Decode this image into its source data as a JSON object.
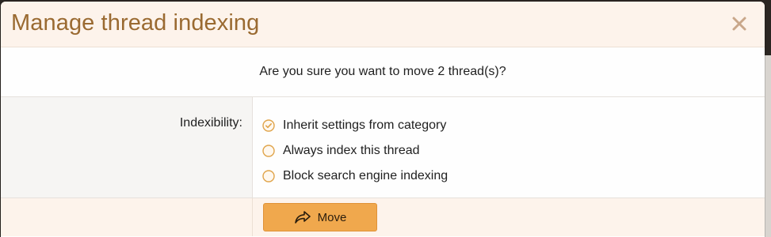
{
  "dialog": {
    "title": "Manage thread indexing",
    "close_icon": "close-icon",
    "confirm_text": "Are you sure you want to move 2 thread(s)?",
    "field": {
      "label": "Indexibility:",
      "options": [
        {
          "label": "Inherit settings from category",
          "selected": true
        },
        {
          "label": "Always index this thread",
          "selected": false
        },
        {
          "label": "Block search engine indexing",
          "selected": false
        }
      ]
    },
    "submit": {
      "label": "Move",
      "icon": "share-forward-icon"
    }
  },
  "colors": {
    "title": "#9a6a31",
    "header_bg": "#fdf3eb",
    "radio_accent": "#e0a44a",
    "button_bg": "#f0a84d"
  }
}
